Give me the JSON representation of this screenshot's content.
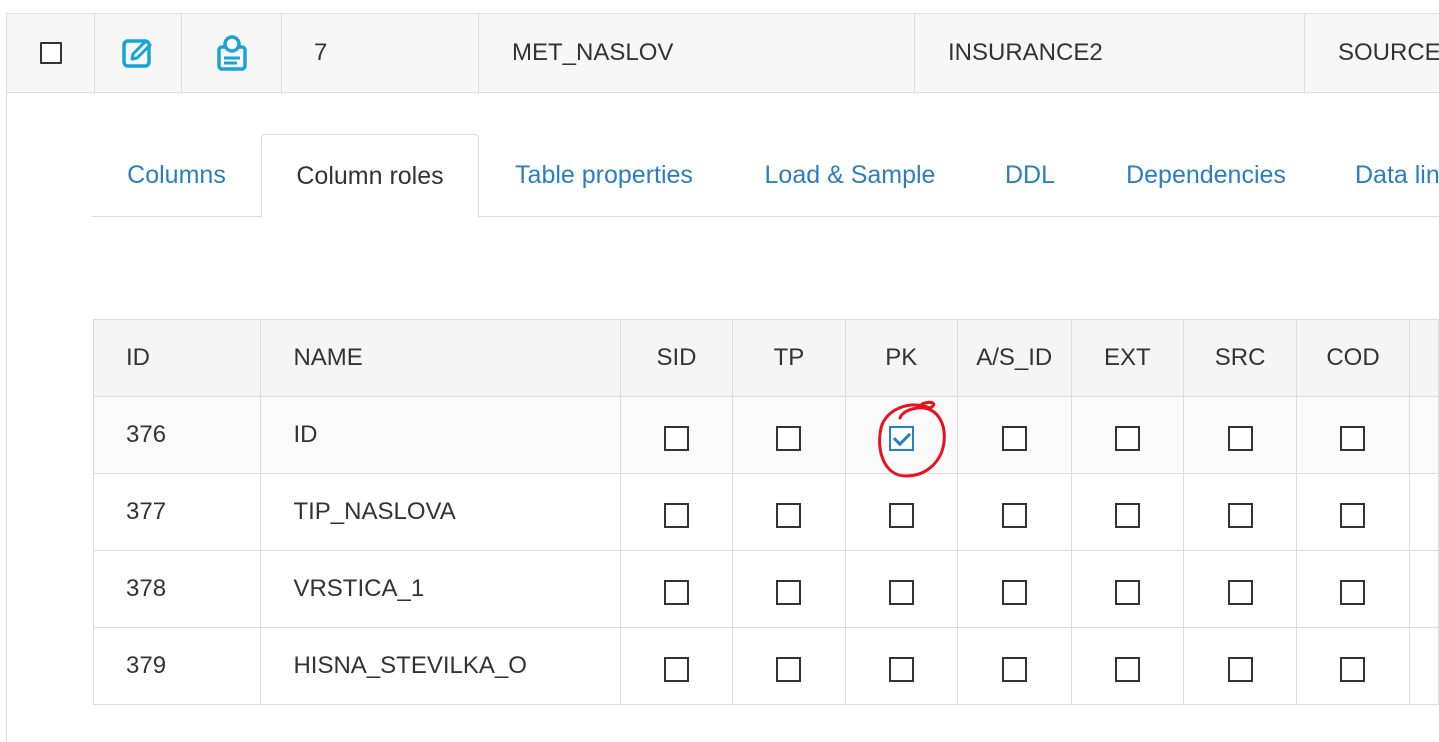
{
  "record_row": {
    "number": "7",
    "name": "MET_NASLOV",
    "database": "INSURANCE2",
    "type": "SOURCE",
    "icons": [
      "edit-icon",
      "certificate-icon"
    ]
  },
  "tabs": [
    {
      "label": "Columns",
      "active": false
    },
    {
      "label": "Column roles",
      "active": true
    },
    {
      "label": "Table properties",
      "active": false
    },
    {
      "label": "Load & Sample",
      "active": false
    },
    {
      "label": "DDL",
      "active": false
    },
    {
      "label": "Dependencies",
      "active": false
    },
    {
      "label": "Data lineage",
      "active": false
    }
  ],
  "table": {
    "headers": [
      "ID",
      "NAME",
      "SID",
      "TP",
      "PK",
      "A/S_ID",
      "EXT",
      "SRC",
      "COD"
    ],
    "rows": [
      {
        "id": "376",
        "name": "ID",
        "flags": [
          false,
          false,
          true,
          false,
          false,
          false,
          false
        ]
      },
      {
        "id": "377",
        "name": "TIP_NASLOVA",
        "flags": [
          false,
          false,
          false,
          false,
          false,
          false,
          false
        ]
      },
      {
        "id": "378",
        "name": "VRSTICA_1",
        "flags": [
          false,
          false,
          false,
          false,
          false,
          false,
          false
        ]
      },
      {
        "id": "379",
        "name": "HISNA_STEVILKA_O",
        "flags": [
          false,
          false,
          false,
          false,
          false,
          false,
          false
        ]
      }
    ]
  },
  "colors": {
    "accent": "#2a7ec2",
    "icon": "#1aa3d6",
    "annotation": "#e8121f"
  }
}
